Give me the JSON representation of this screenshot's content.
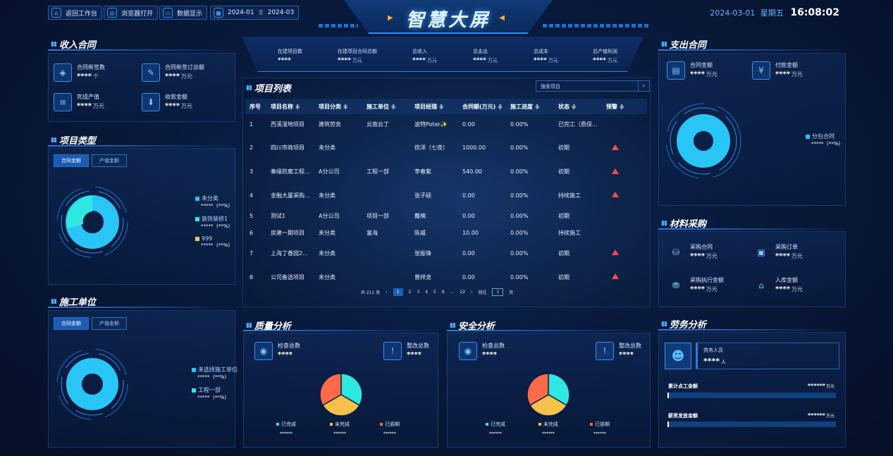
{
  "header": {
    "title": "智慧大屏",
    "buttons": [
      {
        "label": "返回工作台",
        "icon": "home-icon"
      },
      {
        "label": "浏览器打开",
        "icon": "browser-icon"
      },
      {
        "label": "数据显示",
        "icon": "display-icon"
      }
    ],
    "date_range": {
      "start": "2024-01",
      "sep": "至",
      "end": "2024-03"
    },
    "date": "2024-03-01",
    "weekday": "星期五",
    "time": "16:08:02"
  },
  "summary": [
    {
      "label": "在建项目数",
      "value": "****",
      "unit": ""
    },
    {
      "label": "在建项目合同总额",
      "value": "****",
      "unit": "万元"
    },
    {
      "label": "总收入",
      "value": "****",
      "unit": "万元"
    },
    {
      "label": "总支出",
      "value": "****",
      "unit": "万元"
    },
    {
      "label": "总成本",
      "value": "****",
      "unit": "万元"
    },
    {
      "label": "总产值利润",
      "value": "****",
      "unit": "万元"
    }
  ],
  "income": {
    "title": "收入合同",
    "items": [
      {
        "label": "合同新签数",
        "value": "****",
        "unit": "个"
      },
      {
        "label": "合同新签订总额",
        "value": "****",
        "unit": "万元"
      },
      {
        "label": "完成产值",
        "value": "****",
        "unit": "万元"
      },
      {
        "label": "收款金额",
        "value": "****",
        "unit": "万元"
      }
    ]
  },
  "project_type": {
    "title": "项目类型",
    "tabs": [
      "合同金额",
      "产值金额"
    ],
    "legend": [
      {
        "name": "未分类",
        "value": "*****",
        "pct": "(**%)",
        "color": "#29c5f6"
      },
      {
        "name": "装饰装修1",
        "value": "*****",
        "pct": "(**%)",
        "color": "#2ee8e0"
      },
      {
        "name": "999",
        "value": "*****",
        "pct": "(**%)",
        "color": "#f7c04a"
      }
    ]
  },
  "construction_unit": {
    "title": "施工单位",
    "tabs": [
      "合同金额",
      "产值金额"
    ],
    "legend": [
      {
        "name": "未选择施工单位",
        "value": "*****",
        "pct": "(**%)",
        "color": "#29c5f6"
      },
      {
        "name": "工程一部",
        "value": "*****",
        "pct": "(**%)",
        "color": "#2ee8e0"
      }
    ]
  },
  "project_list": {
    "title": "项目列表",
    "search_placeholder": "搜索项目",
    "columns": [
      "序号",
      "项目名称 ≑",
      "项目分类 ≑",
      "施工单位 ≑",
      "项目经理 ≑",
      "合同额(万元) ≑",
      "施工进度 ≑",
      "状态 ≑",
      "预警 ≑"
    ],
    "rows": [
      {
        "no": "1",
        "name": "西溪湿地项目",
        "cat": "建筑劳务",
        "unit": "云南云丁",
        "mgr": "波特Poter✨",
        "amt": "0.00",
        "prog": "0.00%",
        "status": "已完工（质保...",
        "warn": false
      },
      {
        "no": "2",
        "name": "四川市政项目",
        "cat": "未分类",
        "unit": "",
        "mgr": "徐洋（七夜）",
        "amt": "1000.00",
        "prog": "0.00%",
        "status": "初期",
        "warn": true
      },
      {
        "no": "3",
        "name": "秦缘防腐工程...",
        "cat": "A分公司",
        "unit": "工程一部",
        "mgr": "李春紫",
        "amt": "540.00",
        "prog": "0.00%",
        "status": "初期",
        "warn": true
      },
      {
        "no": "4",
        "name": "金融大厦采购...",
        "cat": "未分类",
        "unit": "",
        "mgr": "张子硕",
        "amt": "0.00",
        "prog": "0.00%",
        "status": "持续施工",
        "warn": true
      },
      {
        "no": "5",
        "name": "测试1",
        "cat": "A分公司",
        "unit": "项目一部",
        "mgr": "戴楠",
        "amt": "0.00",
        "prog": "0.00%",
        "status": "初期",
        "warn": false
      },
      {
        "no": "6",
        "name": "房建一期项目",
        "cat": "未分类",
        "unit": "富海",
        "mgr": "陈威",
        "amt": "10.00",
        "prog": "0.00%",
        "status": "持续施工",
        "warn": false
      },
      {
        "no": "7",
        "name": "上海丁香园2...",
        "cat": "未分类",
        "unit": "",
        "mgr": "张振锋",
        "amt": "0.00",
        "prog": "0.00%",
        "status": "初期",
        "warn": true
      },
      {
        "no": "8",
        "name": "公司备选项目",
        "cat": "未分类",
        "unit": "",
        "mgr": "曾祥龙",
        "amt": "0.00",
        "prog": "0.00%",
        "status": "初期",
        "warn": true
      }
    ],
    "pager": {
      "total": "共 211 条",
      "prev": "‹",
      "pages": [
        "1",
        "2",
        "3",
        "4",
        "5",
        "6",
        "...",
        "22"
      ],
      "next": "›",
      "goto": "前往",
      "goto_value": "1",
      "page_suffix": "页"
    }
  },
  "quality": {
    "title": "质量分析",
    "check": {
      "label": "检查总数",
      "value": "****"
    },
    "rectify": {
      "label": "整改总数",
      "value": "****"
    },
    "legend": [
      {
        "name": "已完成",
        "value": "******",
        "color": "#2ee8e0"
      },
      {
        "name": "未完成",
        "value": "******",
        "color": "#f7c04a"
      },
      {
        "name": "已逾期",
        "value": "******",
        "color": "#ff6b4a"
      }
    ]
  },
  "safety": {
    "title": "安全分析",
    "check": {
      "label": "检查总数",
      "value": "****"
    },
    "rectify": {
      "label": "整改总数",
      "value": "****"
    },
    "legend": [
      {
        "name": "已完成",
        "value": "******",
        "color": "#2ee8e0"
      },
      {
        "name": "未完成",
        "value": "******",
        "color": "#f7c04a"
      },
      {
        "name": "已逾期",
        "value": "******",
        "color": "#ff6b4a"
      }
    ]
  },
  "expense": {
    "title": "支出合同",
    "items": [
      {
        "label": "合同金额",
        "value": "****",
        "unit": "万元"
      },
      {
        "label": "付款金额",
        "value": "****",
        "unit": "万元"
      }
    ],
    "legend": [
      {
        "name": "分包合同",
        "value": "*****",
        "pct": "(**%)",
        "color": "#29c5f6"
      }
    ]
  },
  "material": {
    "title": "材料采购",
    "items": [
      {
        "label": "采购合同",
        "value": "****",
        "unit": "万元"
      },
      {
        "label": "采购订单",
        "value": "****",
        "unit": "万元"
      },
      {
        "label": "采购执行金额",
        "value": "****",
        "unit": "万元"
      },
      {
        "label": "入库金额",
        "value": "****",
        "unit": "万元"
      }
    ]
  },
  "labor": {
    "title": "劳务分析",
    "people": {
      "label": "劳务人员",
      "value": "****",
      "unit": "人"
    },
    "bars": [
      {
        "label": "累计点工金额",
        "value": "******",
        "unit": "万元"
      },
      {
        "label": "薪资发放金额",
        "value": "******",
        "unit": "万元"
      }
    ]
  }
}
